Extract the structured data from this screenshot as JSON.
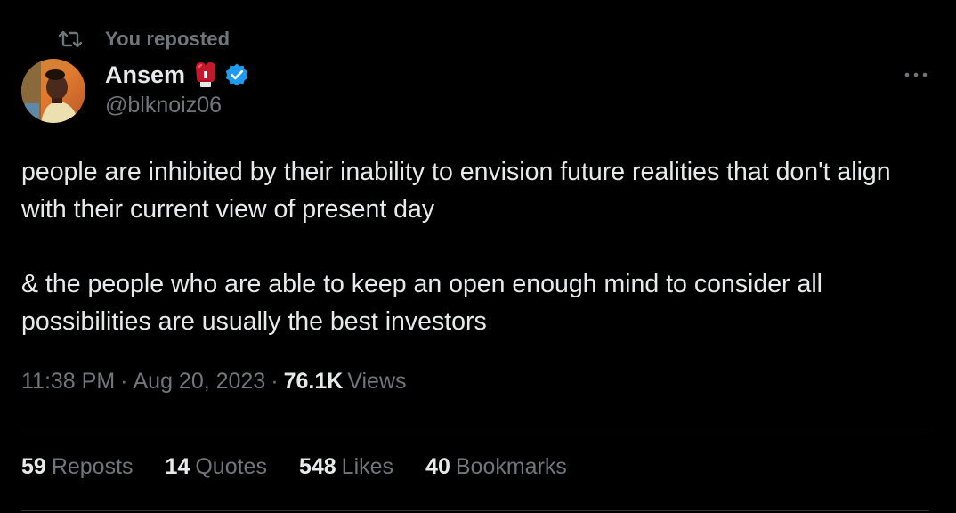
{
  "repost": {
    "icon": "repost-icon",
    "text": "You reposted"
  },
  "author": {
    "display_name": "Ansem",
    "emoji": "boxing-glove-emoji",
    "verified": true,
    "handle": "@blknoiz06",
    "avatar": "profile-photo"
  },
  "tweet": {
    "paragraphs": [
      "people are inhibited by their inability to envision future realities that don't align with their current view of present day",
      "& the people who are able to keep an open enough mind to consider all possibilities are usually the best investors"
    ],
    "time": "11:38 PM",
    "separator": "·",
    "date": "Aug 20, 2023",
    "views_count": "76.1K",
    "views_label": "Views"
  },
  "stats": [
    {
      "count": "59",
      "label": "Reposts"
    },
    {
      "count": "14",
      "label": "Quotes"
    },
    {
      "count": "548",
      "label": "Likes"
    },
    {
      "count": "40",
      "label": "Bookmarks"
    }
  ],
  "colors": {
    "background": "#000000",
    "text_primary": "#e7e9ea",
    "text_secondary": "#71767b",
    "verified_blue": "#1d9bf0",
    "divider": "#2f3336"
  }
}
